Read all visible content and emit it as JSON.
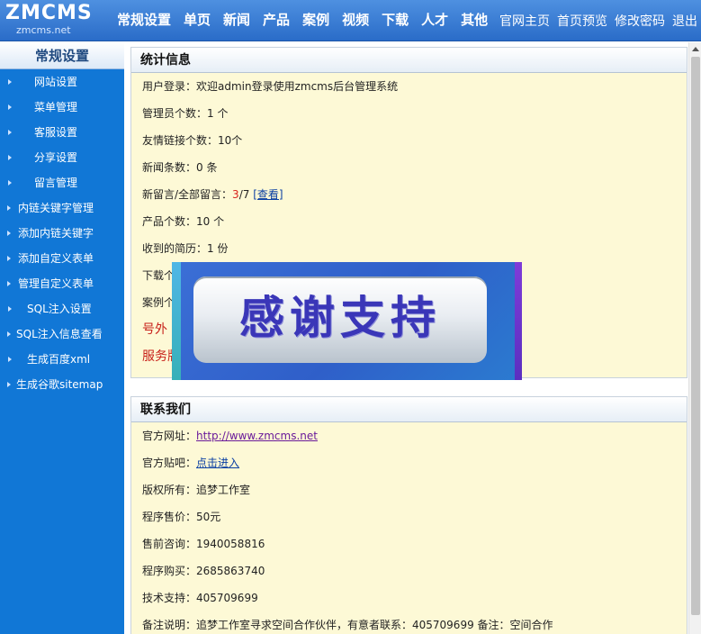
{
  "logo": {
    "main": "ZMCMS",
    "sub": "zmcms.net"
  },
  "main_nav": [
    "常规设置",
    "单页",
    "新闻",
    "产品",
    "案例",
    "视频",
    "下载",
    "人才",
    "其他"
  ],
  "top_links": [
    "官网主页",
    "首页预览",
    "修改密码",
    "退出"
  ],
  "sidebar": {
    "title": "常规设置",
    "items": [
      "网站设置",
      "菜单管理",
      "客服设置",
      "分享设置",
      "留言管理",
      "内链关键字管理",
      "添加内链关键字",
      "添加自定义表单",
      "管理自定义表单",
      "SQL注入设置",
      "SQL注入信息查看",
      "生成百度xml",
      "生成谷歌sitemap"
    ]
  },
  "stats": {
    "title": "统计信息",
    "login": "用户登录：欢迎admin登录使用zmcms后台管理系统",
    "admins": "管理员个数：1 个",
    "links": "友情链接个数：10个",
    "news": "新闻条数：0 条",
    "messages_label": "新留言/全部留言：",
    "messages_new": "3",
    "messages_total": "/7 ",
    "messages_link": "[查看]",
    "products": "产品个数：10 个",
    "resumes": "收到的简历：1 份",
    "downloads": "下载个",
    "cases": "案例个",
    "serial": "号外",
    "service": "服务牌"
  },
  "banner": {
    "text": "感谢支持"
  },
  "contact": {
    "title": "联系我们",
    "site_label": "官方网址：",
    "site_url": "http://www.zmcms.net",
    "forum_label": "官方贴吧：",
    "forum_link": "点击进入",
    "copyright": "版权所有：追梦工作室",
    "price": "程序售价：50元",
    "presale": "售前咨询：1940058816",
    "purchase": "程序购买：2685863740",
    "support": "技术支持：405709699",
    "note": "备注说明：追梦工作室寻求空间合作伙伴，有意者联系：405709699 备注：空间合作"
  }
}
